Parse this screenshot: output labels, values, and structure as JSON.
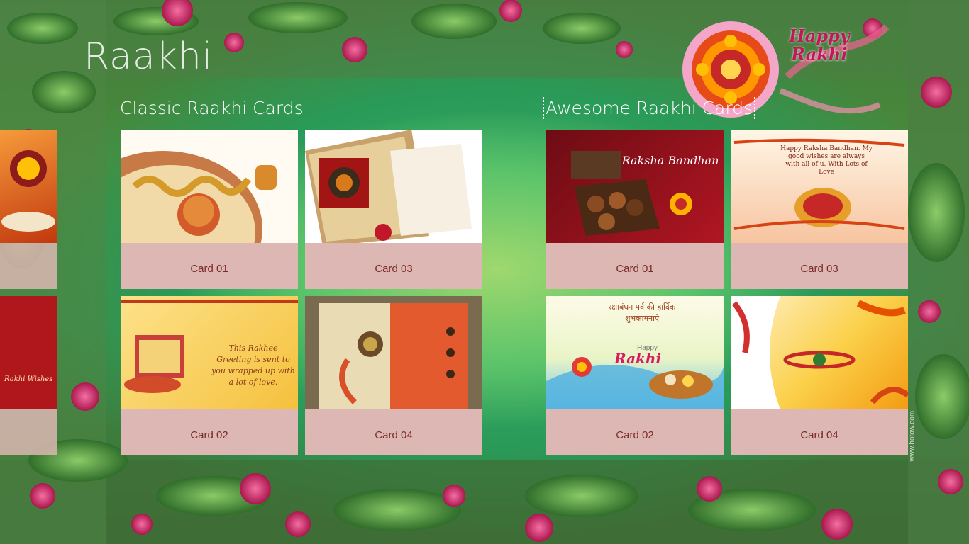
{
  "app": {
    "title": "Raakhi"
  },
  "sections": [
    {
      "title": "Classic Raakhi Cards",
      "cards": [
        {
          "label": "Card 01"
        },
        {
          "label": "Card 03"
        },
        {
          "label": "Card 02"
        },
        {
          "label": "Card 04"
        }
      ]
    },
    {
      "title": "Awesome Raakhi Cards",
      "cards": [
        {
          "label": "Card 01"
        },
        {
          "label": "Card 03"
        },
        {
          "label": "Card 02"
        },
        {
          "label": "Card 04"
        }
      ]
    }
  ],
  "decor": {
    "badge_line1": "Happy",
    "badge_line2": "Rakhi",
    "card_text": {
      "classic_02": "This Rakhee Greeting is sent to you wrapped up with a lot of love.",
      "awesome_01": "Raksha Bandhan",
      "awesome_03": "Happy Raksha Bandhan. My good wishes are always with all of u. With Lots of Love",
      "awesome_02_hindi": "रक्षाबंधन पर्व की हार्दिक शुभकामनाएं",
      "awesome_02_brand_small": "Happy",
      "awesome_02_brand_large": "Rakhi",
      "side_card_tail": "Rakhi Wishes",
      "watermark": "www.hotow.com"
    }
  },
  "colors": {
    "tile_label_bg": "#dcb7b3",
    "tile_label_text": "#7a2a2a",
    "bg_green": "#38b06a",
    "accent_pink": "#c2185b"
  }
}
